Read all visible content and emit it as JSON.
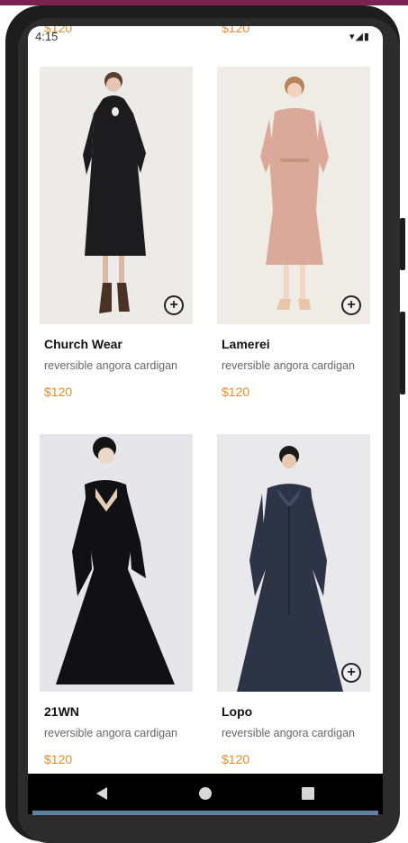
{
  "status_bar": {
    "time": "4:15",
    "icons": "▾◢▮"
  },
  "peek": {
    "price_left": "$120",
    "price_right": "$120"
  },
  "products": [
    {
      "name": "Church Wear",
      "description": "reversible angora cardigan",
      "price": "$120",
      "add_icon": "plus-circle-icon"
    },
    {
      "name": "Lamerei",
      "description": "reversible angora cardigan",
      "price": "$120",
      "add_icon": "plus-circle-icon"
    },
    {
      "name": "21WN",
      "description": "reversible angora cardigan",
      "price": "$120",
      "add_icon": ""
    },
    {
      "name": "Lopo",
      "description": "reversible angora cardigan",
      "price": "$120",
      "add_icon": "plus-circle-icon"
    }
  ],
  "nav": {
    "back": "back-triangle-icon",
    "home": "home-circle-icon",
    "recents": "recents-square-icon"
  },
  "colors": {
    "price": "#e98a2a",
    "accent_bar": "#7a2350"
  }
}
